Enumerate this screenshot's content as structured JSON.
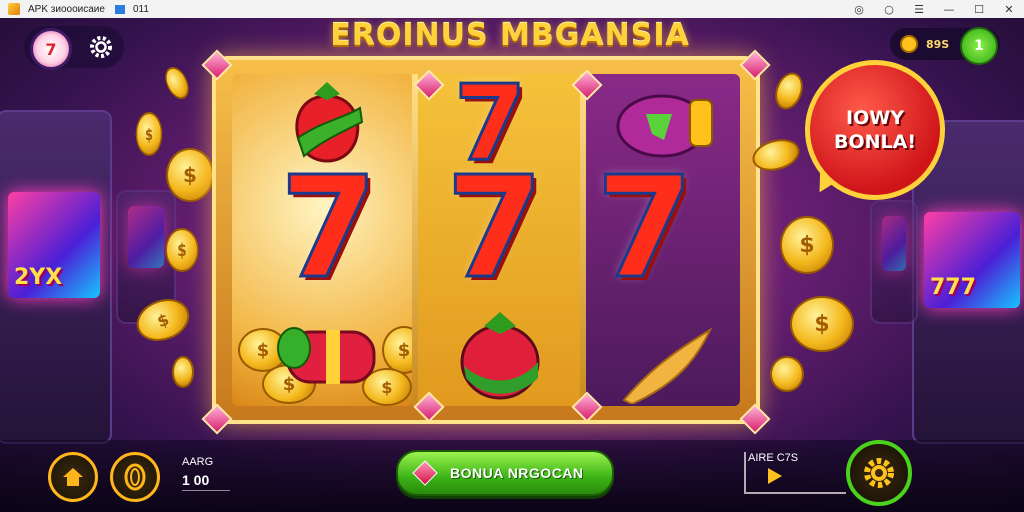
{
  "window": {
    "title": "APK зиоооисаие",
    "extra": "011",
    "controls": [
      "◎",
      "○",
      "☰",
      "—",
      "☐",
      "✕"
    ]
  },
  "header": {
    "avatar_glyph": "7",
    "game_title": "EROINUS MBGANSIA",
    "balance": "89S",
    "add_label": "1"
  },
  "promo_bubble": {
    "line1": "IOWY",
    "line2": "BONLA!"
  },
  "reels": {
    "seven_glyph": "7",
    "coin_glyph": "$"
  },
  "arcade_left": {
    "screen_text": "2YX"
  },
  "arcade_right": {
    "screen_text": "777"
  },
  "footer": {
    "bet_label": "AARG",
    "bet_value": "1 00",
    "bonus_button_label": "BONUA NRGOCAN",
    "auto_label": "AIRE C7S"
  },
  "icons": [
    "gear-icon",
    "home-icon",
    "coin-icon",
    "play-icon",
    "gem-icon",
    "settings-gear-icon"
  ],
  "colors": {
    "accent_gold": "#ffd23a",
    "bonus_green": "#3cb416",
    "promo_red": "#d0151a"
  }
}
